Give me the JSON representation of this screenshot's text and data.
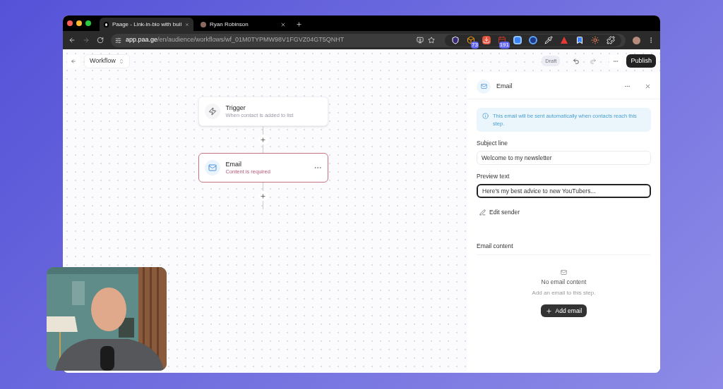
{
  "browser": {
    "tabs": [
      {
        "title": "Paage - Link-in-bio with buil",
        "selected": true
      },
      {
        "title": "Ryan Robinson",
        "selected": false
      }
    ],
    "url_host": "app.paa.ge",
    "url_path": "/en/audience/workflows/wf_01M0TYPMW98V1FGVZ04GT5QNHT",
    "extensions": [
      {
        "kind": "shield"
      },
      {
        "kind": "box",
        "badge": "73"
      },
      {
        "kind": "download"
      },
      {
        "kind": "calendar",
        "badge": "191"
      },
      {
        "kind": "square"
      },
      {
        "kind": "ring"
      },
      {
        "kind": "dropper"
      },
      {
        "kind": "triangle"
      },
      {
        "kind": "bookmark"
      },
      {
        "kind": "sun"
      },
      {
        "kind": "puzzle"
      }
    ]
  },
  "toolbar": {
    "title": "Workflow",
    "status": "Draft",
    "publish": "Publish"
  },
  "nodes": [
    {
      "kind": "trigger",
      "title": "Trigger",
      "subtitle": "When contact is added to list",
      "error": false
    },
    {
      "kind": "email",
      "title": "Email",
      "subtitle": "Content is required",
      "error": true
    }
  ],
  "panel": {
    "title": "Email",
    "info": "This email will be sent automatically when contacts reach this step.",
    "fields": [
      {
        "label": "Subject line",
        "value": "Welcome to my newsletter",
        "focused": false
      },
      {
        "label": "Preview text",
        "value": "Here's my best advice to new YouTubers...",
        "focused": true
      }
    ],
    "edit_sender": "Edit sender",
    "content_label": "Email content",
    "empty_title": "No email content",
    "empty_subtitle": "Add an email to this step.",
    "add_button": "Add email"
  }
}
